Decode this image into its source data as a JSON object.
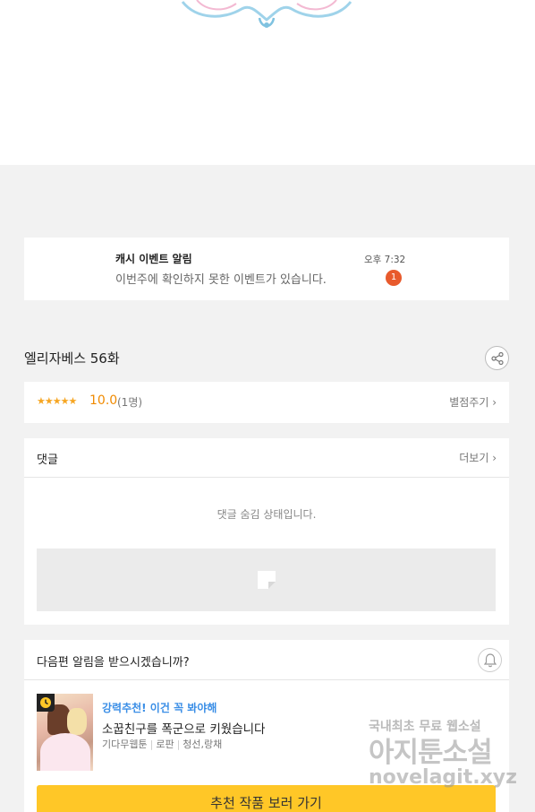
{
  "notification": {
    "title": "캐시 이벤트 알림",
    "message": "이번주에 확인하지 못한 이벤트가 있습니다.",
    "time": "오후 7:32",
    "badge_count": "1"
  },
  "episode": {
    "title": "엘리자베스 56화"
  },
  "rating": {
    "stars": "★★★★★",
    "score": "10.0",
    "count": "(1명)",
    "rate_link": "별점주기 ›"
  },
  "comments": {
    "title": "댓글",
    "more_link": "더보기 ›",
    "hidden_message": "댓글 숨김 상태입니다."
  },
  "next_episode": {
    "question": "다음편 알림을 받으시겠습니까?",
    "recommendation": {
      "tag": "강력추천! 이건 꼭 봐야해",
      "title": "소꿉친구를 폭군으로 키웠습니다",
      "genres": [
        "기다무웹툰",
        "로판",
        "청선,랑채"
      ]
    },
    "cta_label": "추천 작품 보러 가기"
  },
  "watermark": {
    "line1": "국내최초 무료 웹소설",
    "line2": "아지툰소설",
    "line3": "novelagit.xyz"
  },
  "colors": {
    "accent_yellow": "#ffc727",
    "badge_red": "#e85a2c",
    "star_orange": "#f6a623",
    "link_blue": "#3a8ee6"
  }
}
